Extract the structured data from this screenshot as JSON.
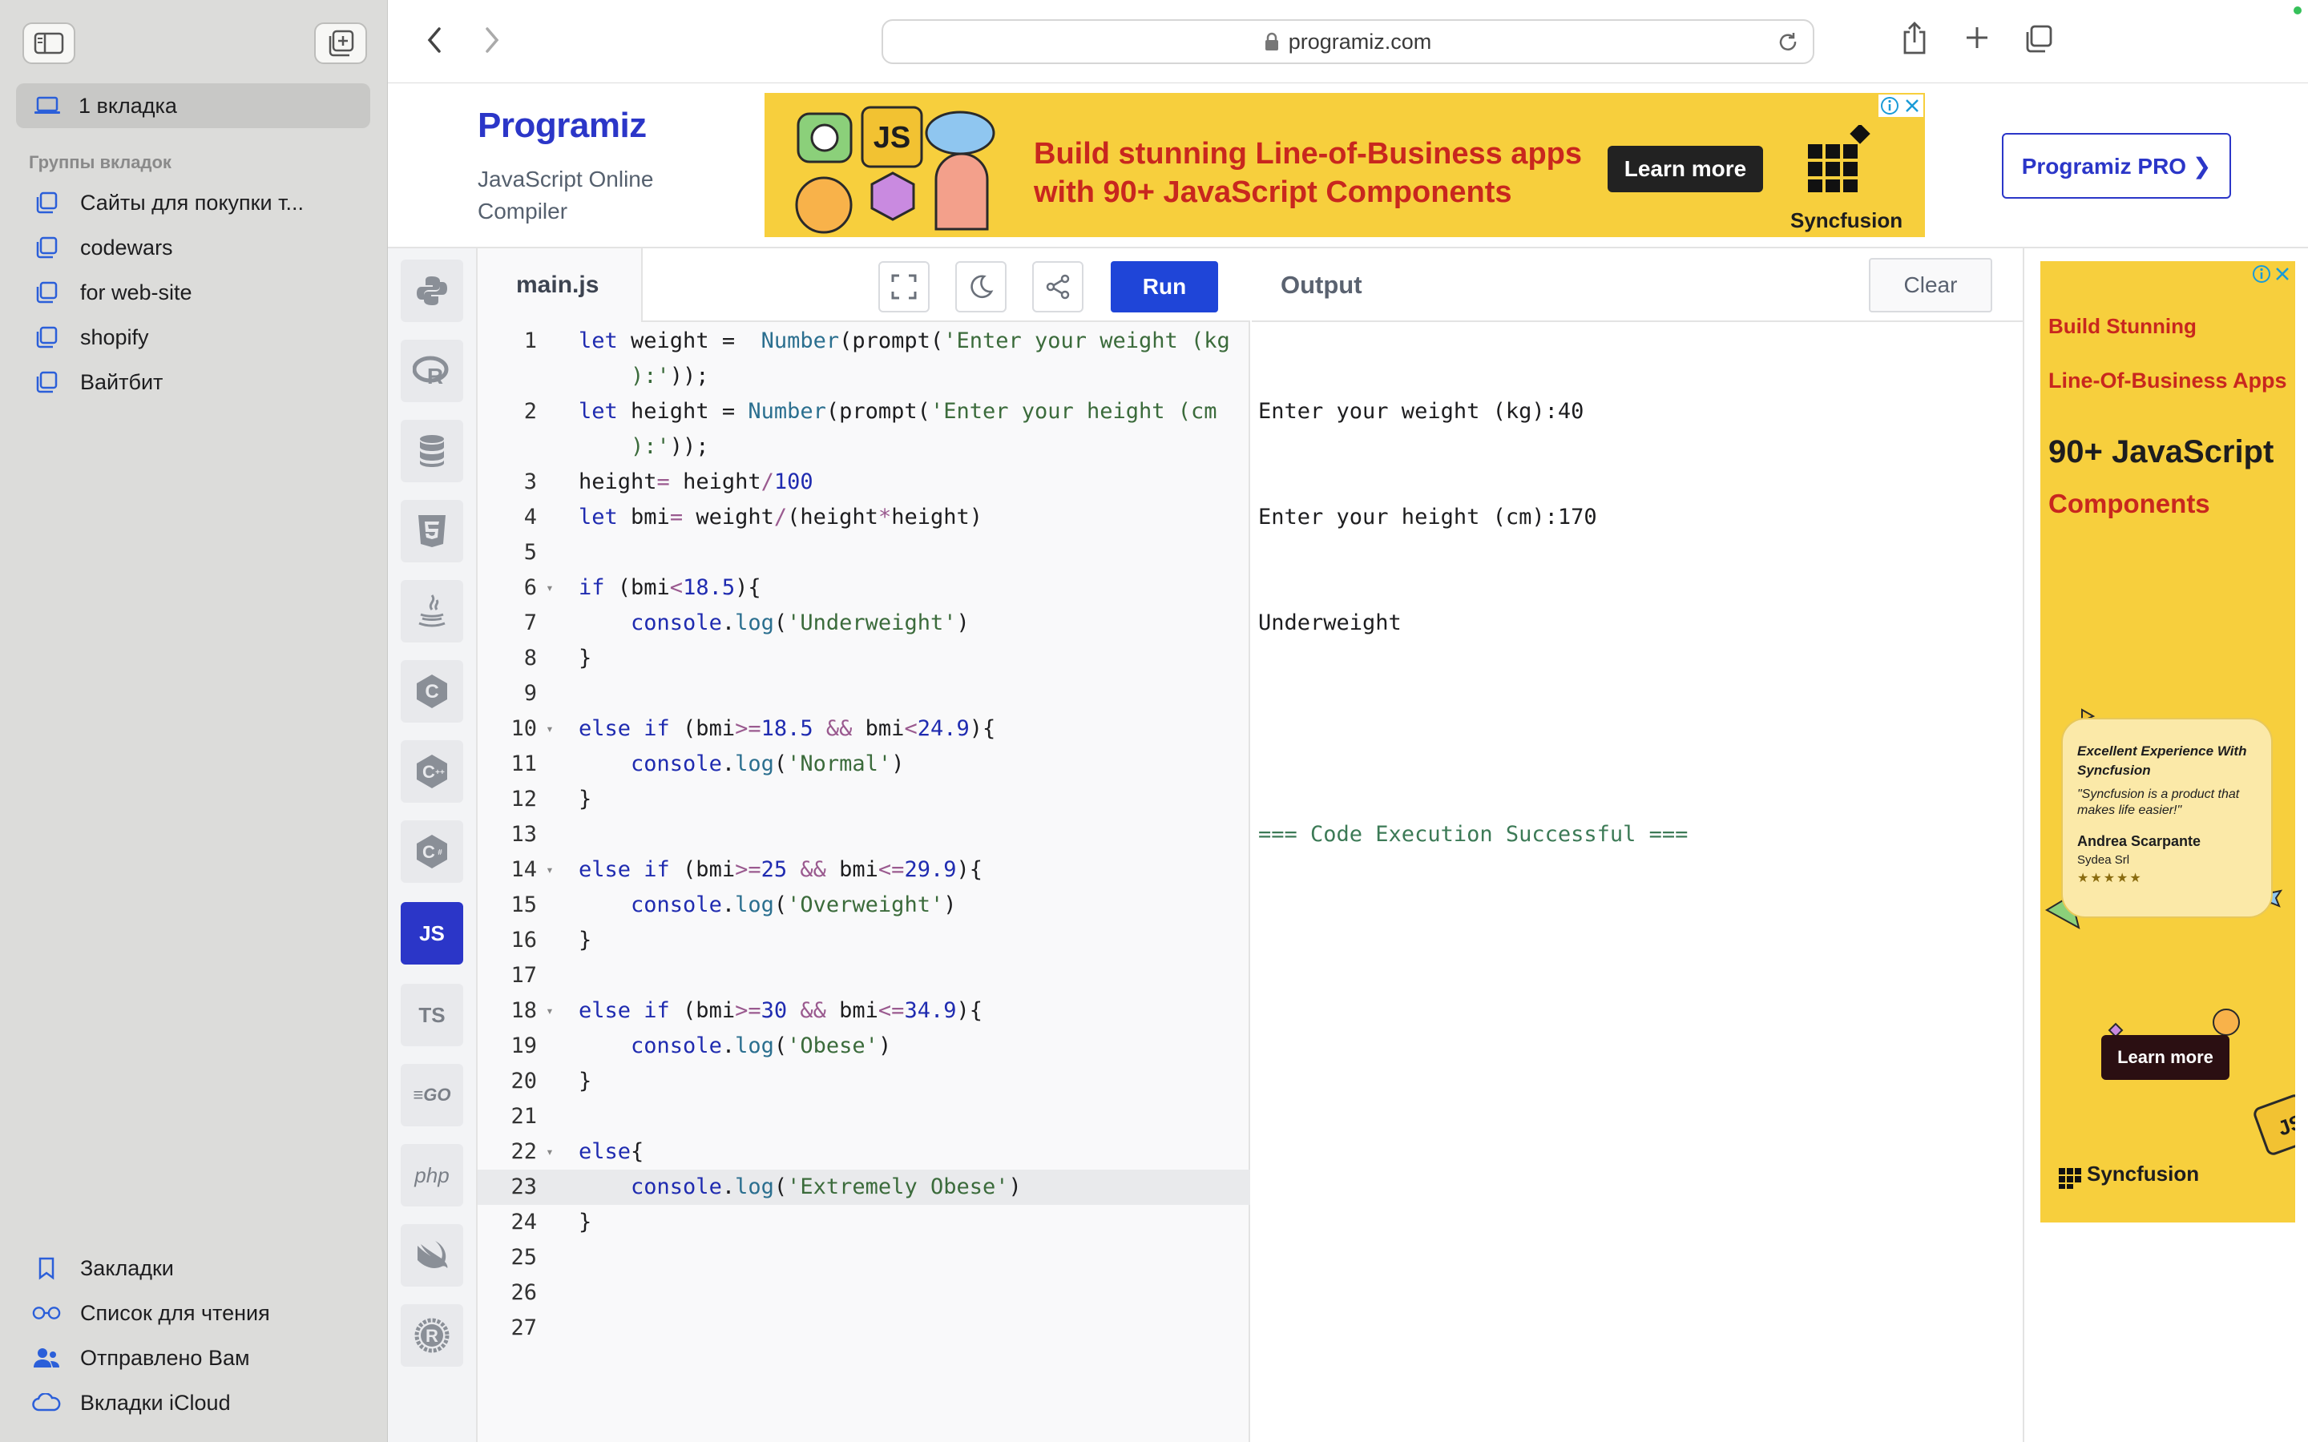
{
  "browser": {
    "url": "programiz.com",
    "sidebar": {
      "current_tab": "1 вкладка",
      "groups_heading": "Группы вкладок",
      "groups": [
        "Сайты для покупки т...",
        "codewars",
        "for web-site",
        "shopify",
        "Вайтбит"
      ],
      "bottom": [
        {
          "label": "Закладки",
          "icon": "bookmark-icon"
        },
        {
          "label": "Список для чтения",
          "icon": "reading-list-icon"
        },
        {
          "label": "Отправлено Вам",
          "icon": "shared-with-you-icon"
        },
        {
          "label": "Вкладки iCloud",
          "icon": "icloud-icon"
        }
      ]
    }
  },
  "site": {
    "logo": "Programiz",
    "subtitle": "JavaScript Online Compiler",
    "pro_button": "Programiz PRO ❯",
    "ad": {
      "line1": "Build stunning Line-of-Business apps",
      "line2": "with 90+ JavaScript Components",
      "cta": "Learn more",
      "brand": "Syncfusion",
      "tile_label": "JS"
    }
  },
  "editor": {
    "file_name": "main.js",
    "run_label": "Run",
    "languages": [
      "python",
      "r",
      "sql",
      "html",
      "java",
      "c",
      "cpp",
      "csharp",
      "JS",
      "TS",
      "GO",
      "php",
      "swift",
      "rust"
    ],
    "active_language": "JS",
    "active_line": 23,
    "lines": [
      [
        [
          "kw",
          "let"
        ],
        [
          "t",
          " weight =  "
        ],
        [
          "fn",
          "Number"
        ],
        [
          "t",
          "(prompt("
        ],
        [
          "str",
          "'Enter your weight (kg"
        ]
      ],
      [
        [
          "str",
          "    ):'"
        ],
        [
          "t",
          "));"
        ]
      ],
      [
        [
          "kw",
          "let"
        ],
        [
          "t",
          " height = "
        ],
        [
          "fn",
          "Number"
        ],
        [
          "t",
          "(prompt("
        ],
        [
          "str",
          "'Enter your height (cm"
        ]
      ],
      [
        [
          "str",
          "    ):'"
        ],
        [
          "t",
          "));"
        ]
      ],
      [
        [
          "t",
          "height"
        ],
        [
          "op",
          "="
        ],
        [
          "t",
          " height"
        ],
        [
          "op",
          "/"
        ],
        [
          "num",
          "100"
        ]
      ],
      [
        [
          "kw",
          "let"
        ],
        [
          "t",
          " bmi"
        ],
        [
          "op",
          "="
        ],
        [
          "t",
          " weight"
        ],
        [
          "op",
          "/"
        ],
        [
          "t",
          "(height"
        ],
        [
          "op",
          "*"
        ],
        [
          "t",
          "height)"
        ]
      ],
      [],
      [
        [
          "kw",
          "if"
        ],
        [
          "t",
          " (bmi"
        ],
        [
          "op",
          "<"
        ],
        [
          "num",
          "18.5"
        ],
        [
          "t",
          "){"
        ]
      ],
      [
        [
          "t",
          "    "
        ],
        [
          "obj",
          "console"
        ],
        [
          "t",
          "."
        ],
        [
          "fn",
          "log"
        ],
        [
          "t",
          "("
        ],
        [
          "str",
          "'Underweight'"
        ],
        [
          "t",
          ")"
        ]
      ],
      [
        [
          "t",
          "}"
        ]
      ],
      [],
      [
        [
          "kw",
          "else if"
        ],
        [
          "t",
          " (bmi"
        ],
        [
          "op",
          ">="
        ],
        [
          "num",
          "18.5"
        ],
        [
          "t",
          " "
        ],
        [
          "op",
          "&&"
        ],
        [
          "t",
          " bmi"
        ],
        [
          "op",
          "<"
        ],
        [
          "num",
          "24.9"
        ],
        [
          "t",
          "){"
        ]
      ],
      [
        [
          "t",
          "    "
        ],
        [
          "obj",
          "console"
        ],
        [
          "t",
          "."
        ],
        [
          "fn",
          "log"
        ],
        [
          "t",
          "("
        ],
        [
          "str",
          "'Normal'"
        ],
        [
          "t",
          ")"
        ]
      ],
      [
        [
          "t",
          "}"
        ]
      ],
      [],
      [
        [
          "kw",
          "else if"
        ],
        [
          "t",
          " (bmi"
        ],
        [
          "op",
          ">="
        ],
        [
          "num",
          "25"
        ],
        [
          "t",
          " "
        ],
        [
          "op",
          "&&"
        ],
        [
          "t",
          " bmi"
        ],
        [
          "op",
          "<="
        ],
        [
          "num",
          "29.9"
        ],
        [
          "t",
          "){"
        ]
      ],
      [
        [
          "t",
          "    "
        ],
        [
          "obj",
          "console"
        ],
        [
          "t",
          "."
        ],
        [
          "fn",
          "log"
        ],
        [
          "t",
          "("
        ],
        [
          "str",
          "'Overweight'"
        ],
        [
          "t",
          ")"
        ]
      ],
      [
        [
          "t",
          "}"
        ]
      ],
      [],
      [
        [
          "kw",
          "else if"
        ],
        [
          "t",
          " (bmi"
        ],
        [
          "op",
          ">="
        ],
        [
          "num",
          "30"
        ],
        [
          "t",
          " "
        ],
        [
          "op",
          "&&"
        ],
        [
          "t",
          " bmi"
        ],
        [
          "op",
          "<="
        ],
        [
          "num",
          "34.9"
        ],
        [
          "t",
          "){"
        ]
      ],
      [
        [
          "t",
          "    "
        ],
        [
          "obj",
          "console"
        ],
        [
          "t",
          "."
        ],
        [
          "fn",
          "log"
        ],
        [
          "t",
          "("
        ],
        [
          "str",
          "'Obese'"
        ],
        [
          "t",
          ")"
        ]
      ],
      [
        [
          "t",
          "}"
        ]
      ],
      [],
      [
        [
          "kw",
          "else"
        ],
        [
          "t",
          "{"
        ]
      ],
      [
        [
          "t",
          "    "
        ],
        [
          "obj",
          "console"
        ],
        [
          "t",
          "."
        ],
        [
          "fn",
          "log"
        ],
        [
          "t",
          "("
        ],
        [
          "str",
          "'Extremely Obese'"
        ],
        [
          "t",
          ")"
        ]
      ],
      [
        [
          "t",
          "}"
        ]
      ],
      [],
      [],
      []
    ],
    "line_numbers": [
      "1",
      "",
      "2",
      "",
      "3",
      "4",
      "5",
      "6",
      "7",
      "8",
      "9",
      "10",
      "11",
      "12",
      "13",
      "14",
      "15",
      "16",
      "17",
      "18",
      "19",
      "20",
      "21",
      "22",
      "23",
      "24",
      "25",
      "26",
      "27"
    ],
    "fold_lines": [
      "6",
      "10",
      "14",
      "18",
      "22"
    ]
  },
  "output": {
    "title": "Output",
    "clear_label": "Clear",
    "lines": [
      "Enter your weight (kg):40",
      "Enter your height (cm):170",
      "Underweight",
      ""
    ],
    "status": "=== Code Execution Successful ==="
  },
  "side_ad": {
    "line1": "Build Stunning",
    "line2": "Line-Of-Business Apps",
    "line3": "90+ JavaScript",
    "line4": "Components",
    "card_heading": "Excellent Experience With Syncfusion",
    "card_quote": "\"Syncfusion is a product that makes life easier!\"",
    "card_name": "Andrea Scarpante",
    "card_company": "Sydea Srl",
    "card_stars": "★★★★★",
    "cta": "Learn more",
    "brand": "Syncfusion",
    "corner_label": "JS"
  }
}
